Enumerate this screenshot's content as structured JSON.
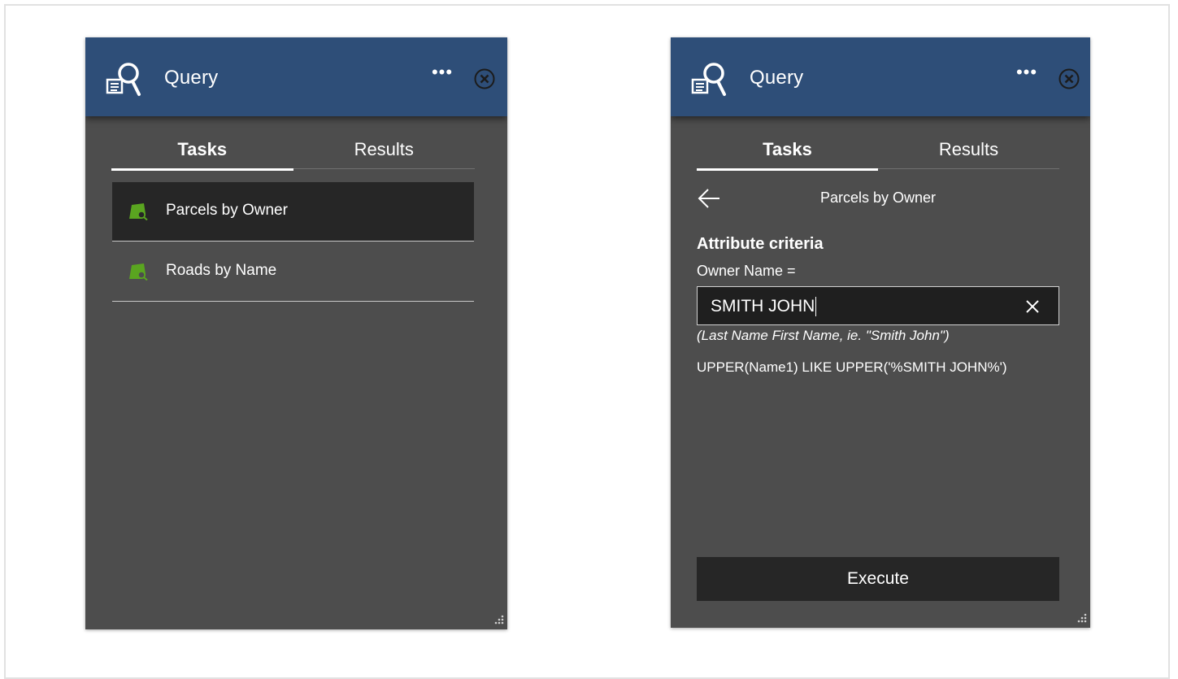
{
  "colors": {
    "header_bg": "#2e4e78",
    "panel_bg": "#4d4d4d",
    "selected_bg": "#262626",
    "icon_green": "#5aa520"
  },
  "left_panel": {
    "title": "Query",
    "more_label": "•••",
    "tabs": [
      {
        "label": "Tasks",
        "active": true
      },
      {
        "label": "Results",
        "active": false
      }
    ],
    "tasks": [
      {
        "label": "Parcels by Owner",
        "icon": "layer-search-icon",
        "selected": true
      },
      {
        "label": "Roads by Name",
        "icon": "layer-search-icon",
        "selected": false
      }
    ]
  },
  "right_panel": {
    "title": "Query",
    "more_label": "•••",
    "tabs": [
      {
        "label": "Tasks",
        "active": true
      },
      {
        "label": "Results",
        "active": false
      }
    ],
    "task_title": "Parcels by Owner",
    "section_heading": "Attribute criteria",
    "field_label": "Owner Name =",
    "input_value": "SMITH JOHN",
    "hint": "(Last Name First Name, ie. \"Smith John\")",
    "expression": "UPPER(Name1) LIKE UPPER('%SMITH JOHN%')",
    "execute_label": "Execute"
  }
}
